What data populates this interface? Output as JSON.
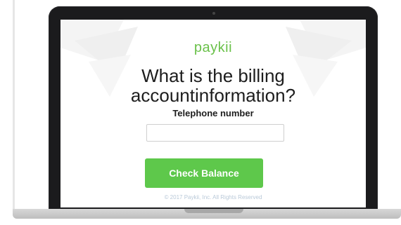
{
  "app": {
    "logo_text": "paykii",
    "heading_line1": "What is the billing",
    "heading_line2": "accountinformation?",
    "field_label": "Telephone number",
    "field_value": "",
    "field_placeholder": "",
    "button_label": "Check Balance",
    "footer": "© 2017 Paykii, Inc. All Rights Reserved"
  },
  "colors": {
    "brand_green": "#6ac14a",
    "button_green": "#5ec84b",
    "laptop_bezel": "#1b1b1d"
  }
}
